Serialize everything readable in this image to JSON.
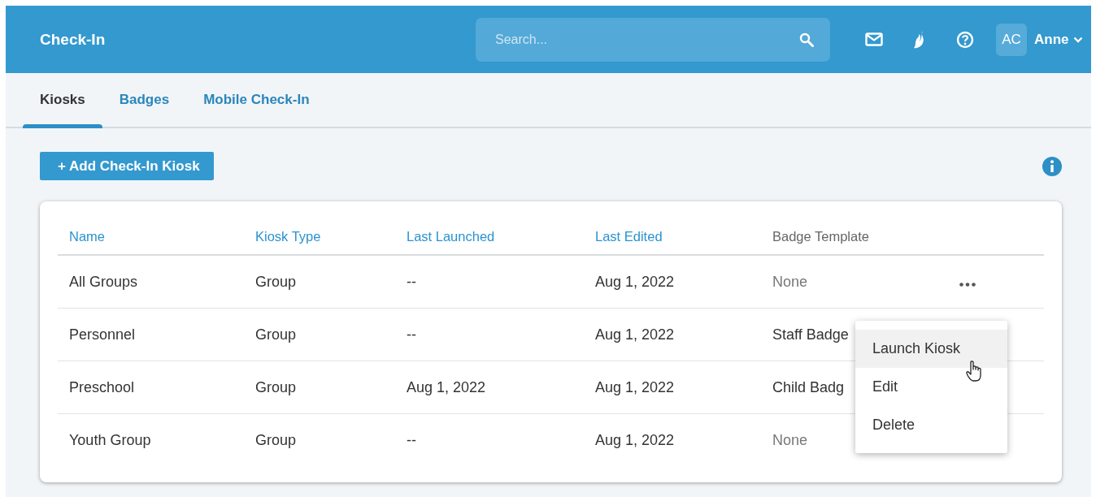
{
  "header": {
    "title": "Check-In",
    "search": {
      "placeholder": "Search..."
    },
    "avatar": "AC",
    "user": "Anne"
  },
  "tabs": [
    {
      "label": "Kiosks",
      "selected": true
    },
    {
      "label": "Badges",
      "selected": false
    },
    {
      "label": "Mobile Check-In",
      "selected": false
    }
  ],
  "add_button": "+ Add Check-In Kiosk",
  "table": {
    "columns": [
      {
        "label": "Name",
        "sortable": true
      },
      {
        "label": "Kiosk Type",
        "sortable": true
      },
      {
        "label": "Last Launched",
        "sortable": true
      },
      {
        "label": "Last Edited",
        "sortable": true
      },
      {
        "label": "Badge Template",
        "sortable": false
      }
    ],
    "rows": [
      {
        "name": "All Groups",
        "kiosk_type": "Group",
        "last_launched": "--",
        "last_edited": "Aug 1, 2022",
        "badge_template": {
          "text": "None",
          "muted": true
        },
        "menu_button": true
      },
      {
        "name": "Personnel",
        "kiosk_type": "Group",
        "last_launched": "--",
        "last_edited": "Aug 1, 2022",
        "badge_template": {
          "text": "Staff Badge",
          "muted": false
        },
        "menu_button": false
      },
      {
        "name": "Preschool",
        "kiosk_type": "Group",
        "last_launched": "Aug 1, 2022",
        "last_edited": "Aug 1, 2022",
        "badge_template": {
          "text": "Child Badg",
          "muted": false
        },
        "menu_button": false
      },
      {
        "name": "Youth Group",
        "kiosk_type": "Group",
        "last_launched": "--",
        "last_edited": "Aug 1, 2022",
        "badge_template": {
          "text": "None",
          "muted": true
        },
        "menu_button": false
      }
    ]
  },
  "context_menu": [
    {
      "label": "Launch Kiosk",
      "selected": true
    },
    {
      "label": "Edit",
      "selected": false
    },
    {
      "label": "Delete",
      "selected": false
    }
  ]
}
